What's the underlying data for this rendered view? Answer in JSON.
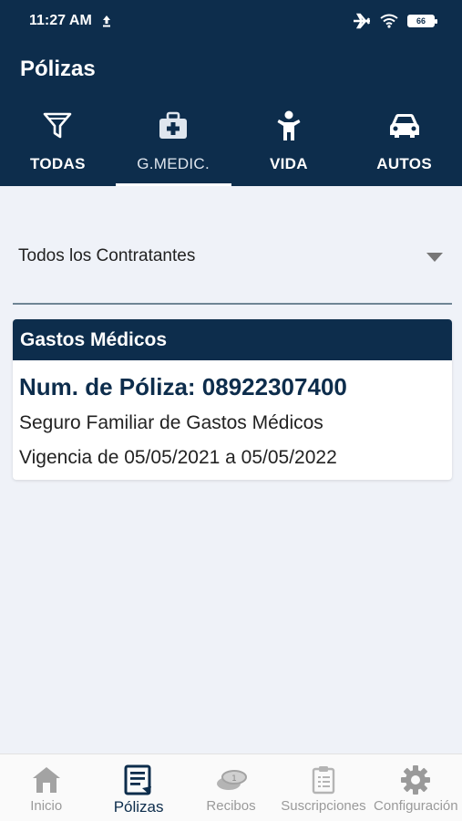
{
  "status_bar": {
    "time": "11:27 AM",
    "battery": "66",
    "icons": [
      "upload-icon",
      "airplane-icon",
      "wifi-icon",
      "battery-icon"
    ]
  },
  "header": {
    "title": "Pólizas",
    "tabs": [
      {
        "label": "TODAS",
        "icon": "filter-icon",
        "active": false
      },
      {
        "label": "G.MEDIC.",
        "icon": "medical-kit-icon",
        "active": true
      },
      {
        "label": "VIDA",
        "icon": "person-icon",
        "active": false
      },
      {
        "label": "AUTOS",
        "icon": "car-icon",
        "active": false
      }
    ]
  },
  "contractor_select": {
    "value": "Todos los Contratantes"
  },
  "policy_card": {
    "header": "Gastos Médicos",
    "policy_number": "Num. de Póliza: 08922307400",
    "description": "Seguro Familiar de Gastos Médicos",
    "validity": "Vigencia de 05/05/2021 a 05/05/2022"
  },
  "bottom_nav": {
    "items": [
      {
        "label": "Inicio",
        "icon": "home-icon",
        "active": false
      },
      {
        "label": "Pólizas",
        "icon": "policy-document-icon",
        "active": true
      },
      {
        "label": "Recibos",
        "icon": "coins-icon",
        "active": false
      },
      {
        "label": "Suscripciones",
        "icon": "clipboard-icon",
        "active": false
      },
      {
        "label": "Configuración",
        "icon": "gear-icon",
        "active": false
      }
    ]
  },
  "colors": {
    "primary": "#0d2d4c",
    "background": "#eff2f8",
    "inactive_nav": "#9a9a9a"
  }
}
